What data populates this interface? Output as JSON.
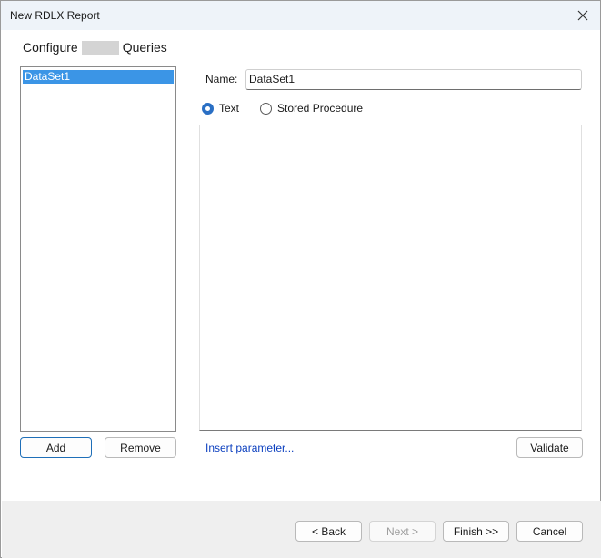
{
  "window": {
    "title": "New RDLX Report",
    "close_icon": "close-icon"
  },
  "heading": {
    "prefix": "Configure",
    "suffix": "Queries"
  },
  "datasets": {
    "items": [
      {
        "label": "DataSet1",
        "selected": true
      }
    ]
  },
  "list_buttons": {
    "add": "Add",
    "remove": "Remove"
  },
  "form": {
    "name_label": "Name:",
    "name_value": "DataSet1",
    "command_type": {
      "options": [
        {
          "label": "Text",
          "checked": true
        },
        {
          "label": "Stored Procedure",
          "checked": false
        }
      ]
    },
    "query_text": "",
    "insert_parameter": "Insert parameter...",
    "validate": "Validate"
  },
  "footer": {
    "back": "< Back",
    "next": "Next >",
    "next_enabled": false,
    "finish": "Finish >>",
    "cancel": "Cancel"
  },
  "colors": {
    "selection": "#3b95e6",
    "radio_accent": "#2a6fc4",
    "link": "#0b3fbf",
    "title_bar": "#eef3f9",
    "footer_bg": "#efefef"
  }
}
